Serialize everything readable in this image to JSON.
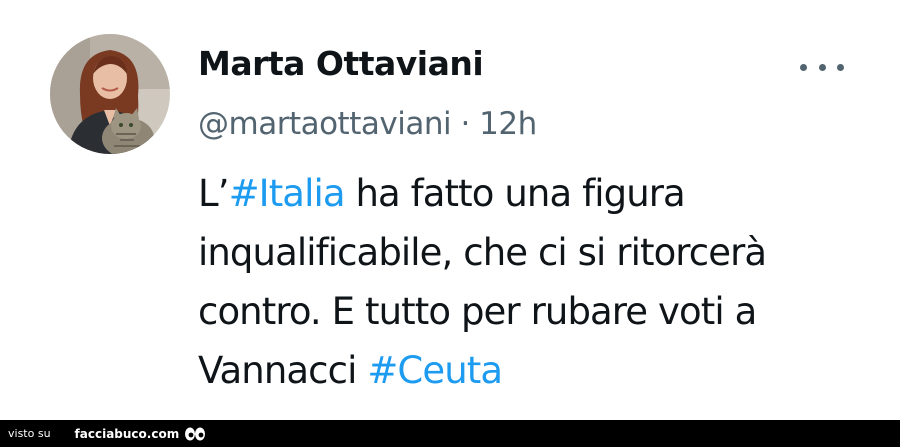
{
  "tweet": {
    "author": {
      "display_name": "Marta Ottaviani",
      "handle": "@martaottaviani",
      "avatar_icon": "profile-photo"
    },
    "separator": "·",
    "timestamp": "12h",
    "more_icon": "more-horizontal-icon",
    "text": {
      "line1_prefix": "L’",
      "line1_hashtag": "#Italia",
      "line1_suffix": " ha fatto una figura",
      "line2": "inqualificabile, che ci si ritorcerà",
      "line3": "contro. E tutto per rubare voti a",
      "line4_prefix": "Vannacci ",
      "line4_hashtag": "#Ceuta"
    }
  },
  "watermark": {
    "prefix": "visto su",
    "site": "facciabuco.com",
    "logo_icon": "eyes-icon"
  },
  "colors": {
    "text": "#0f1419",
    "secondary": "#536471",
    "hashtag": "#1d9bf0",
    "background": "#ffffff",
    "watermark_bg": "#000000"
  }
}
